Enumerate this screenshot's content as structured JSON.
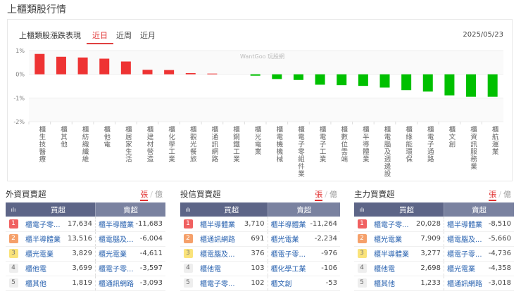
{
  "page_title": "上櫃類股行情",
  "card": {
    "title": "上櫃類股漲跌表現",
    "tabs": [
      "近日",
      "近周",
      "近月"
    ],
    "active_tab": 0,
    "date": "2025/05/23",
    "watermark": "WantGoo 玩股網"
  },
  "colors": {
    "up": "#ee3333",
    "down": "#00c000",
    "header_buy": "#5d6587",
    "header_sell": "#7a82a0"
  },
  "chart_data": {
    "type": "bar",
    "title": "上櫃類股漲跌表現",
    "ylabel": "%",
    "ylim": [
      -2,
      1
    ],
    "yticks": [
      "1%",
      "0%",
      "-1%",
      "-2%"
    ],
    "categories": [
      "櫃生技醫療",
      "櫃其他",
      "櫃紡織纖維",
      "櫃他電",
      "櫃居家生活",
      "櫃建材營造",
      "櫃化學工業",
      "櫃觀光餐旅",
      "櫃通訊網路",
      "櫃鋼鐵工業",
      "櫃光電業",
      "櫃電機機械",
      "櫃電子零組件業",
      "櫃電子工業",
      "櫃數位雲端",
      "櫃半導體業",
      "櫃電腦及週邊設",
      "櫃綠能環保",
      "櫃電子通路",
      "櫃文創",
      "櫃資訊服務業",
      "櫃航運業"
    ],
    "values": [
      0.86,
      0.74,
      0.71,
      0.66,
      0.54,
      0.19,
      0.18,
      0.05,
      0.03,
      0.0,
      -0.06,
      -0.2,
      -0.24,
      -0.44,
      -0.46,
      -0.49,
      -0.56,
      -0.67,
      -0.73,
      -0.89,
      -0.95,
      -0.95
    ]
  },
  "panels": [
    {
      "title": "外資買賣超",
      "unit_on": "張",
      "unit_off": "億",
      "buy_header": "買超",
      "sell_header": "賣超",
      "chart_icon": "ılı",
      "rows": [
        {
          "rank": "1",
          "buy": "櫃電子零...",
          "buy_val": "17,634",
          "sell": "櫃半導體業",
          "sell_val": "-11,683"
        },
        {
          "rank": "2",
          "buy": "櫃半導體業",
          "buy_val": "13,516",
          "sell": "櫃電腦及...",
          "sell_val": "-6,004"
        },
        {
          "rank": "3",
          "buy": "櫃光電業",
          "buy_val": "3,829",
          "sell": "櫃光電業",
          "sell_val": "-4,611"
        },
        {
          "rank": "4",
          "buy": "櫃他電",
          "buy_val": "3,699",
          "sell": "櫃電子零...",
          "sell_val": "-3,597"
        },
        {
          "rank": "5",
          "buy": "櫃其他",
          "buy_val": "1,819",
          "sell": "櫃通訊網路",
          "sell_val": "-3,093"
        }
      ]
    },
    {
      "title": "投信買賣超",
      "unit_on": "張",
      "unit_off": "億",
      "buy_header": "買超",
      "sell_header": "賣超",
      "chart_icon": "ılı",
      "rows": [
        {
          "rank": "1",
          "buy": "櫃半導體業",
          "buy_val": "3,710",
          "sell": "櫃半導體業",
          "sell_val": "-11,264"
        },
        {
          "rank": "2",
          "buy": "櫃通訊網路",
          "buy_val": "691",
          "sell": "櫃光電業",
          "sell_val": "-2,234"
        },
        {
          "rank": "3",
          "buy": "櫃電腦及...",
          "buy_val": "376",
          "sell": "櫃電子零...",
          "sell_val": "-976"
        },
        {
          "rank": "4",
          "buy": "櫃他電",
          "buy_val": "103",
          "sell": "櫃化學工業",
          "sell_val": "-106"
        },
        {
          "rank": "5",
          "buy": "櫃電子零...",
          "buy_val": "102",
          "sell": "櫃文創",
          "sell_val": "-53"
        }
      ]
    },
    {
      "title": "主力買賣超",
      "unit_on": "張",
      "unit_off": "億",
      "buy_header": "買超",
      "sell_header": "賣超",
      "chart_icon": "ılı",
      "rows": [
        {
          "rank": "1",
          "buy": "櫃電子零...",
          "buy_val": "20,028",
          "sell": "櫃半導體業",
          "sell_val": "-8,510"
        },
        {
          "rank": "2",
          "buy": "櫃光電業",
          "buy_val": "7,909",
          "sell": "櫃電腦及...",
          "sell_val": "-5,660"
        },
        {
          "rank": "3",
          "buy": "櫃半導體業",
          "buy_val": "3,277",
          "sell": "櫃電子零...",
          "sell_val": "-4,736"
        },
        {
          "rank": "4",
          "buy": "櫃他電",
          "buy_val": "2,698",
          "sell": "櫃光電業",
          "sell_val": "-4,358"
        },
        {
          "rank": "5",
          "buy": "櫃其他",
          "buy_val": "1,233",
          "sell": "櫃通訊網路",
          "sell_val": "-3,018"
        }
      ]
    }
  ]
}
